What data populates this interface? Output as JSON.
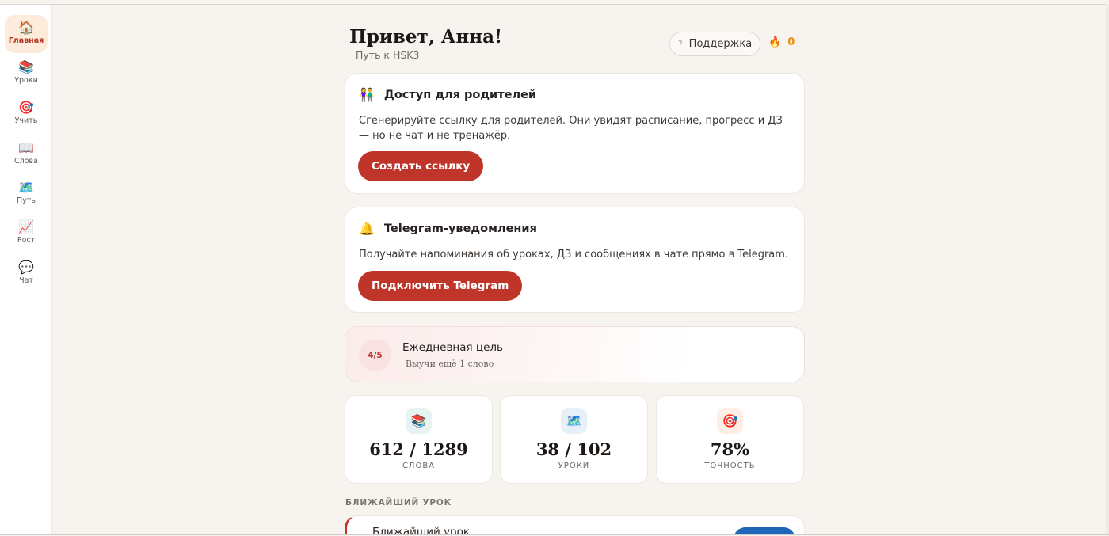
{
  "sidebar": {
    "items": [
      {
        "icon": "🏠",
        "icon_name": "home-icon",
        "label": "Главная",
        "active": true
      },
      {
        "icon": "📚",
        "icon_name": "books-icon",
        "label": "Уроки"
      },
      {
        "icon": "🎯",
        "icon_name": "target-icon",
        "label": "Учить"
      },
      {
        "icon": "📖",
        "icon_name": "open-book-icon",
        "label": "Слова"
      },
      {
        "icon": "🗺️",
        "icon_name": "map-icon",
        "label": "Путь"
      },
      {
        "icon": "📈",
        "icon_name": "chart-up-icon",
        "label": "Рост"
      },
      {
        "icon": "💬",
        "icon_name": "speech-bubble-icon",
        "label": "Чат"
      }
    ]
  },
  "header": {
    "greeting": "Привет, Анна!",
    "subtitle": "Путь к HSK3",
    "support_icon": "?",
    "support_label": "Поддержка",
    "streak_icon": "🔥",
    "streak_count": "0"
  },
  "parents_card": {
    "icon": "👫",
    "title": "Доступ для родителей",
    "text": "Сгенерируйте ссылку для родителей. Они увидят расписание, прогресс и ДЗ — но не чат и не тренажёр.",
    "button": "Создать ссылку"
  },
  "telegram_card": {
    "icon": "🔔",
    "title": "Telegram-уведомления",
    "text": "Получайте напоминания об уроках, ДЗ и сообщениях в чате прямо в Telegram.",
    "button": "Подключить Telegram"
  },
  "daily_goal": {
    "progress": "4/5",
    "title": "Ежедневная цель",
    "subtitle": "Выучи ещё 1 слово"
  },
  "stats": [
    {
      "icon": "📚",
      "icon_name": "books-icon",
      "value": "612 / 1289",
      "label": "СЛОВА",
      "bg": "#e7f3f1"
    },
    {
      "icon": "🗺️",
      "icon_name": "map-icon",
      "value": "38 / 102",
      "label": "УРОКИ",
      "bg": "#e6f0f8"
    },
    {
      "icon": "🎯",
      "icon_name": "target-icon",
      "value": "78%",
      "label": "ТОЧНОСТЬ",
      "bg": "#fdeee6"
    }
  ],
  "next_lesson": {
    "section_label": "БЛИЖАЙШИЙ УРОК",
    "title": "Ближайший урок"
  },
  "colors": {
    "accent": "#c0352a",
    "streak": "#e8910c",
    "background": "#f7f4ef"
  }
}
